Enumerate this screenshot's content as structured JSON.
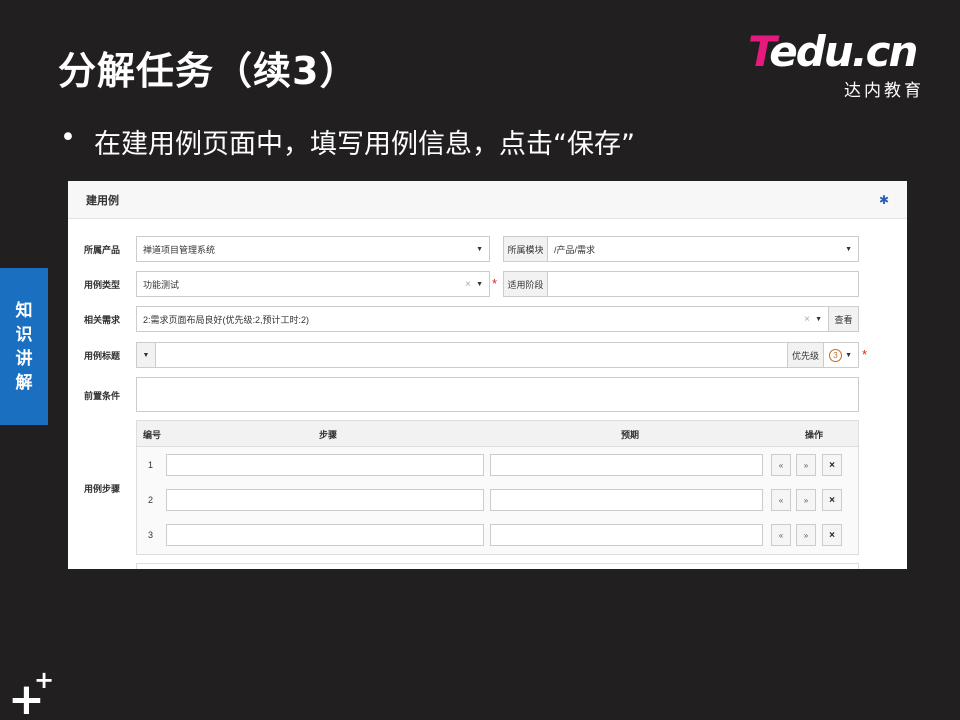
{
  "slide": {
    "title": "分解任务（续3）",
    "bullet": "在建用例页面中，填写用例信息，点击“保存”",
    "side_tab": [
      "知",
      "识",
      "讲",
      "解"
    ],
    "logo": {
      "brand_t": "T",
      "brand_rest": "edu.cn",
      "subtitle": "达内教育"
    }
  },
  "form": {
    "panel_title": "建用例",
    "settings_icon": "gear-icon",
    "product_label": "所属产品",
    "product_value": "禅道项目管理系统",
    "module_label": "所属模块",
    "module_value": "/产品/需求",
    "type_label": "用例类型",
    "type_value": "功能测试",
    "stage_label": "适用阶段",
    "stage_value": "",
    "story_label": "相关需求",
    "story_value": "2:需求页面布局良好(优先级:2,预计工时:2)",
    "view_button": "查看",
    "case_title_label": "用例标题",
    "case_title_value": "",
    "priority_label": "优先级",
    "priority_value": "3",
    "precondition_label": "前置条件",
    "precondition_value": "",
    "steps_label": "用例步骤",
    "steps_columns": {
      "no": "编号",
      "step": "步骤",
      "expect": "预期",
      "ops": "操作"
    },
    "steps": [
      {
        "no": "1",
        "step": "",
        "expect": ""
      },
      {
        "no": "2",
        "step": "",
        "expect": ""
      },
      {
        "no": "3",
        "step": "",
        "expect": ""
      }
    ],
    "op_icons": {
      "up": "«",
      "down": "»",
      "delete": "×"
    }
  },
  "colors": {
    "background": "#221f20",
    "accent_blue": "#1b6fc0",
    "logo_pink": "#e6197d",
    "required_red": "#d9261c"
  }
}
